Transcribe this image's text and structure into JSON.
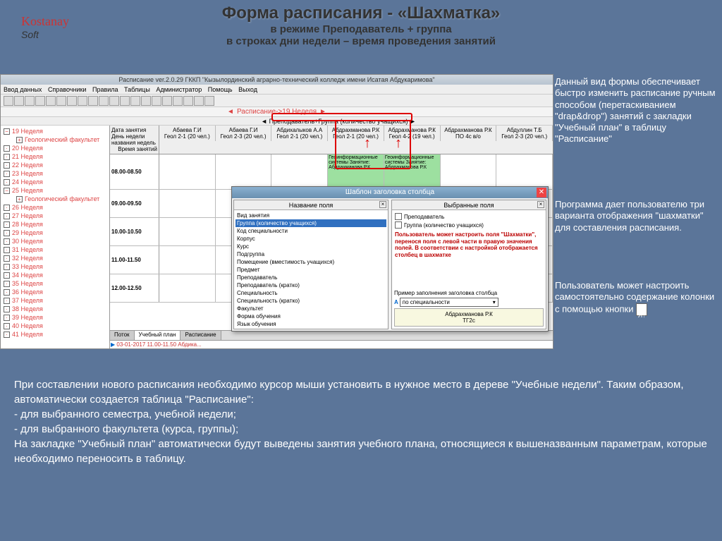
{
  "slide": {
    "title": "Форма расписания - «Шахматка»",
    "sub1": "в режиме Преподаватель + группа",
    "sub2": "в строках дни недели – время проведения занятий"
  },
  "logo": {
    "name": "Kostanay",
    "suffix": "Soft"
  },
  "app": {
    "title": "Расписание ver.2.0.29 ГККП \"Кызылординский аграрно-технический колледж имени Исатая Абдукаримова\"",
    "menu": [
      "Ввод данных",
      "Справочники",
      "Правила",
      "Таблицы",
      "Администратор",
      "Помощь",
      "Выход"
    ],
    "subtitle": "Расписание->19 Неделя",
    "group_header": "Преподаватель+Группа (количество учащихся)",
    "corner": {
      "l1": "Дата занятия",
      "l2": "День недели",
      "l3": "названия недель",
      "l4": "Время занятий"
    },
    "columns": [
      {
        "t": "Абаева Г.И",
        "g": "Геол 2-1 (20 чел.)"
      },
      {
        "t": "Абаева Г.И",
        "g": "Геол 2-3 (20 чел.)"
      },
      {
        "t": "Абдихалыков А.А",
        "g": "Геол 2-1 (20 чел.)"
      },
      {
        "t": "Абдрахманова Р.К",
        "g": "Геол 2-1 (20 чел.)"
      },
      {
        "t": "Абдрахманова Р.К",
        "g": "Геол 4-2 (19 чел.)"
      },
      {
        "t": "Абдрахманова Р.К",
        "g": "ПО 4с в/о"
      },
      {
        "t": "Абдуллин Т.Б",
        "g": "Геол 2-3 (20 чел.)"
      }
    ],
    "times": [
      "08.00-08.50",
      "09.00-09.50",
      "10.00-10.50",
      "11.00-11.50",
      "12.00-12.50"
    ],
    "lesson": "Геоинформационные системы Занятие: Абдрахманова Р.К",
    "tree": {
      "w19": "19 Неделя",
      "faculty": "Геологический факультет",
      "weeks": [
        "20 Неделя",
        "21 Неделя",
        "22 Неделя",
        "23 Неделя",
        "24 Неделя"
      ],
      "w25": "25 Неделя",
      "weeks2": [
        "26 Неделя",
        "27 Неделя",
        "28 Неделя",
        "29 Неделя",
        "30 Неделя",
        "31 Неделя",
        "32 Неделя",
        "33 Неделя",
        "34 Неделя",
        "35 Неделя",
        "36 Неделя",
        "37 Неделя",
        "38 Неделя",
        "39 Неделя",
        "40 Неделя",
        "41 Неделя"
      ]
    },
    "tabs": [
      "Поток",
      "Учебный план",
      "Расписание"
    ],
    "tab_row": "03-01-2017 11.00-11.50   Абдика..."
  },
  "dlg": {
    "title": "Шаблон заголовка столбца",
    "left_title": "Название поля",
    "right_title": "Выбранные поля",
    "fields": [
      "Вид занятия",
      "Группа (количество учащихся)",
      "Код специальности",
      "Корпус",
      "Курс",
      "Подгруппа",
      "Помещение (вместимость учащихся)",
      "Предмет",
      "Преподаватель",
      "Преподаватель (кратко)",
      "Специальность",
      "Специальность (кратко)",
      "Факультет",
      "Форма обучения",
      "Язык обучения"
    ],
    "selected": [
      "Преподаватель",
      "Группа (количество учащихся)"
    ],
    "warn": "Пользователь может настроить поля \"Шахматки\", перенося поля с левой части в правую значения полей. В соответствии с настройкой отображается столбец в шахматке",
    "example_label": "Пример заполнения заголовка столбца",
    "example_sel": "по специальности",
    "example_txt1": "Абдрахманова Р.К",
    "example_txt2": "ТГ2с"
  },
  "side": {
    "p1": "Данный вид формы обеспечивает быстро изменить расписание ручным способом (перетаскиванием \"drap&drop\") занятий с закладки \"Учебный план\" в таблицу \"Расписание\"",
    "p2": "Программа дает пользователю три варианта отображения \"шахматки\" для составления расписания.",
    "p3": "Пользователь может настроить самостоятельно содержание колонки с помощью кнопки"
  },
  "bottom": {
    "p1": "При составлении нового расписания необходимо курсор мыши установить в нужное место в дереве \"Учебные недели\". Таким образом, автоматически создается таблица \"Расписание\":",
    "b1": "- для выбранного семестра, учебной недели;",
    "b2": "- для выбранного факультета (курса, группы);",
    "p2": "На закладке \"Учебный план\" автоматически будут выведены занятия учебного плана, относящиеся к вышеназванным параметрам, которые необходимо переносить в таблицу."
  }
}
